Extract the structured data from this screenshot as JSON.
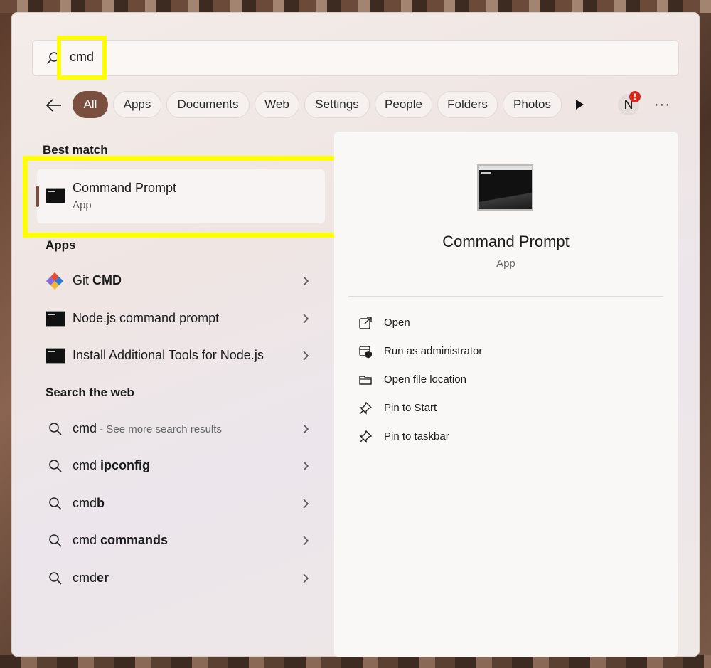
{
  "search": {
    "query": "cmd"
  },
  "filters": {
    "items": [
      "All",
      "Apps",
      "Documents",
      "Web",
      "Settings",
      "People",
      "Folders",
      "Photos"
    ],
    "active": "All",
    "avatar_initial": "N",
    "badge": "!",
    "more": "···"
  },
  "best_match": {
    "section_title": "Best match",
    "name": "Command Prompt",
    "type": "App"
  },
  "apps": {
    "section_title": "Apps",
    "items": [
      {
        "prefix": "Git ",
        "bold": "CMD",
        "icon": "git-icon"
      },
      {
        "prefix": "Node.js command prompt",
        "bold": "",
        "icon": "cmd-icon"
      },
      {
        "prefix": "Install Additional Tools for Node.js",
        "bold": "",
        "icon": "cmd-icon"
      }
    ]
  },
  "web": {
    "section_title": "Search the web",
    "items": [
      {
        "prefix": "cmd",
        "bold": "",
        "suffix": " - See more search results"
      },
      {
        "prefix": "cmd ",
        "bold": "ipconfig",
        "suffix": ""
      },
      {
        "prefix": "cmd",
        "bold": "b",
        "suffix": ""
      },
      {
        "prefix": "cmd ",
        "bold": "commands",
        "suffix": ""
      },
      {
        "prefix": "cmd",
        "bold": "er",
        "suffix": ""
      }
    ]
  },
  "details": {
    "title": "Command Prompt",
    "subtitle": "App",
    "actions": [
      {
        "label": "Open",
        "icon": "open-external-icon"
      },
      {
        "label": "Run as administrator",
        "icon": "shield-admin-icon"
      },
      {
        "label": "Open file location",
        "icon": "folder-icon"
      },
      {
        "label": "Pin to Start",
        "icon": "pin-icon"
      },
      {
        "label": "Pin to taskbar",
        "icon": "pin-icon"
      }
    ]
  },
  "colors": {
    "accent": "#7a4f3f",
    "highlight": "#ffff00",
    "badge": "#d42a1e"
  }
}
